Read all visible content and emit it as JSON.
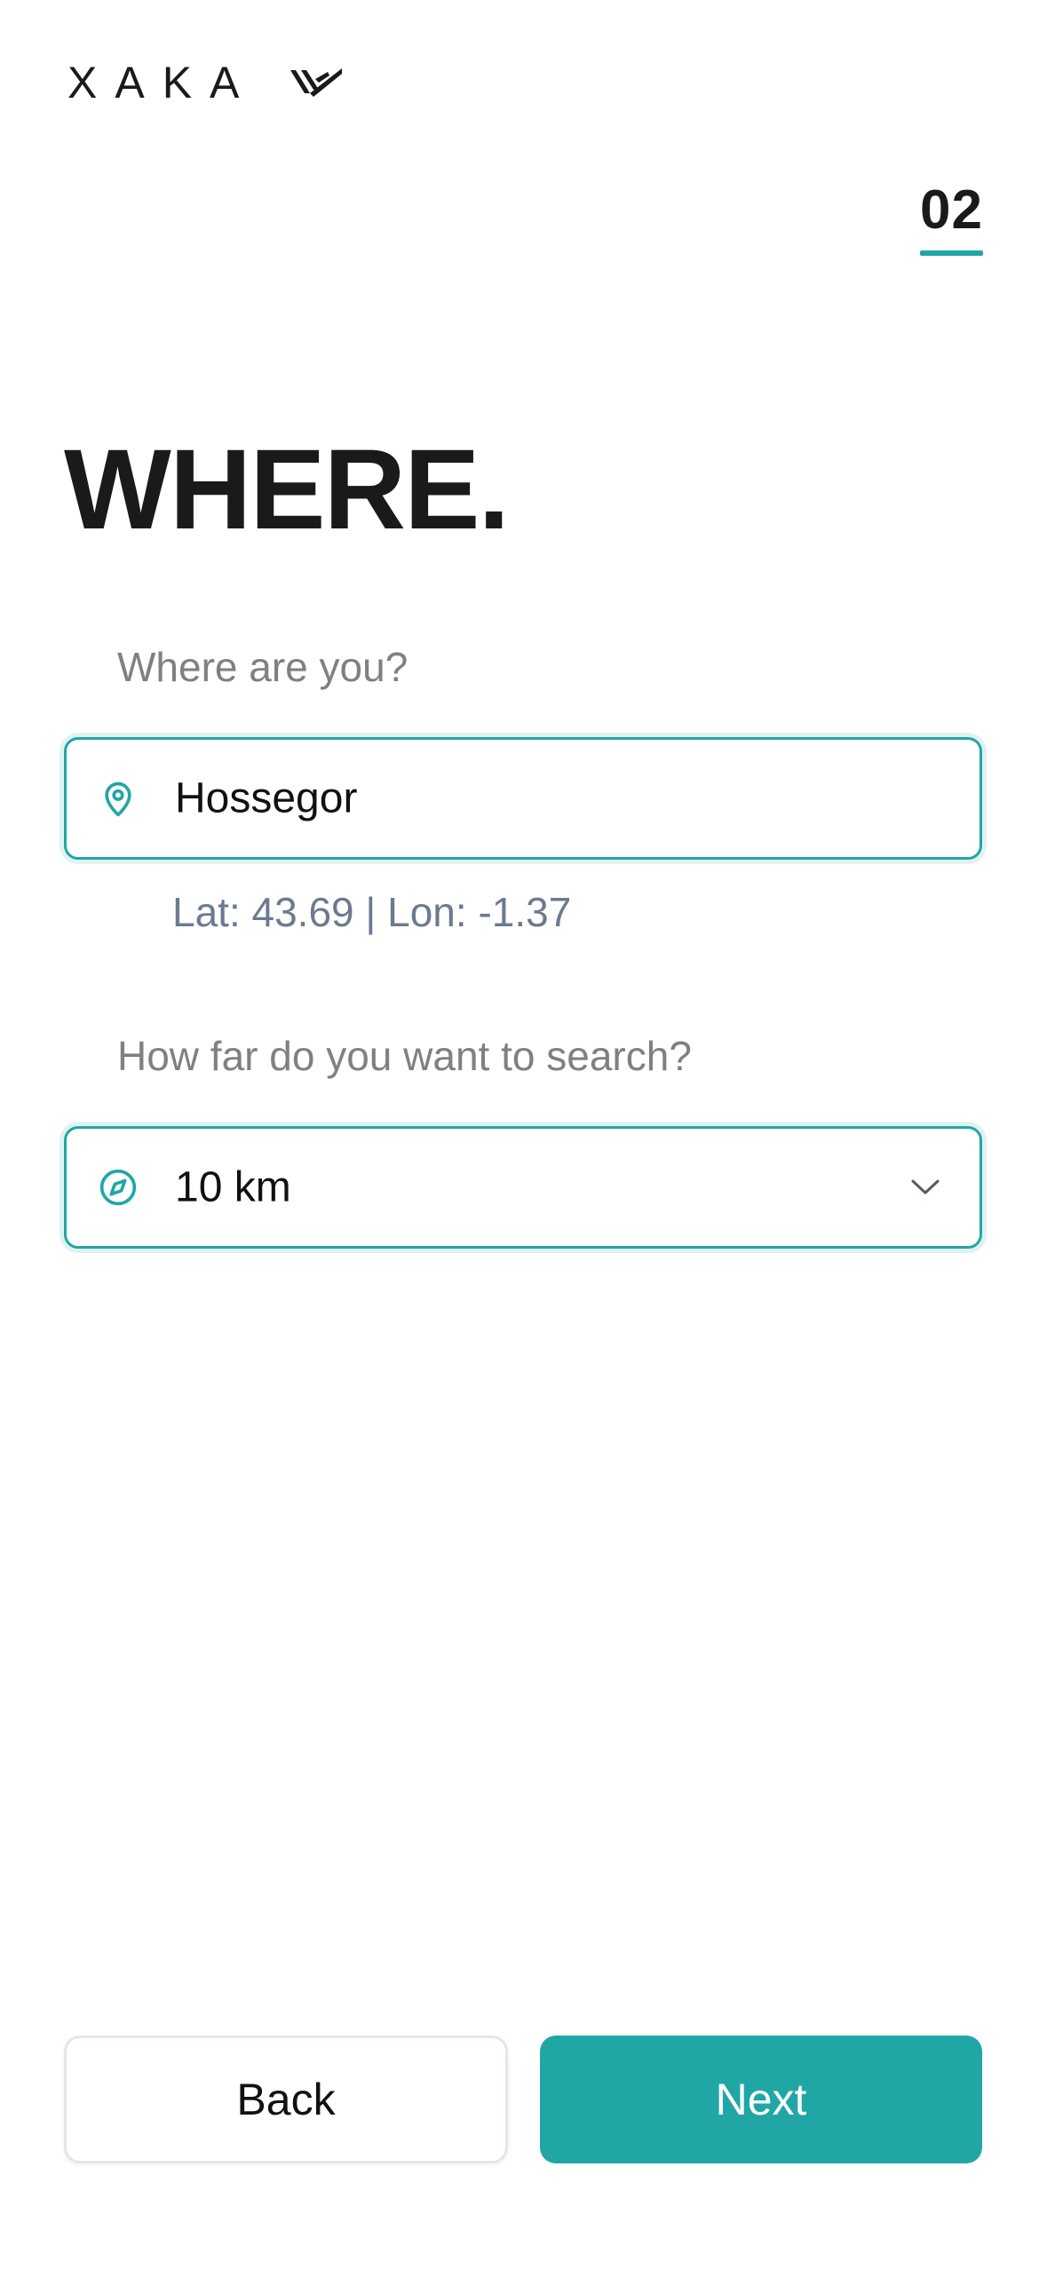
{
  "brand": {
    "logo_text": "XAKA",
    "logo_mark_icon": "shaka-hand-icon",
    "accent_color": "#21a6a6"
  },
  "step": {
    "number": "02"
  },
  "title": "WHERE.",
  "location": {
    "label": "Where are you?",
    "value": "Hossegor",
    "icon": "map-pin-icon",
    "coordinates": "Lat: 43.69 | Lon: -1.37"
  },
  "radius": {
    "label": "How far do you want to search?",
    "selected": "10 km",
    "icon": "compass-icon",
    "dropdown_icon": "chevron-down-icon"
  },
  "actions": {
    "back_label": "Back",
    "next_label": "Next"
  }
}
